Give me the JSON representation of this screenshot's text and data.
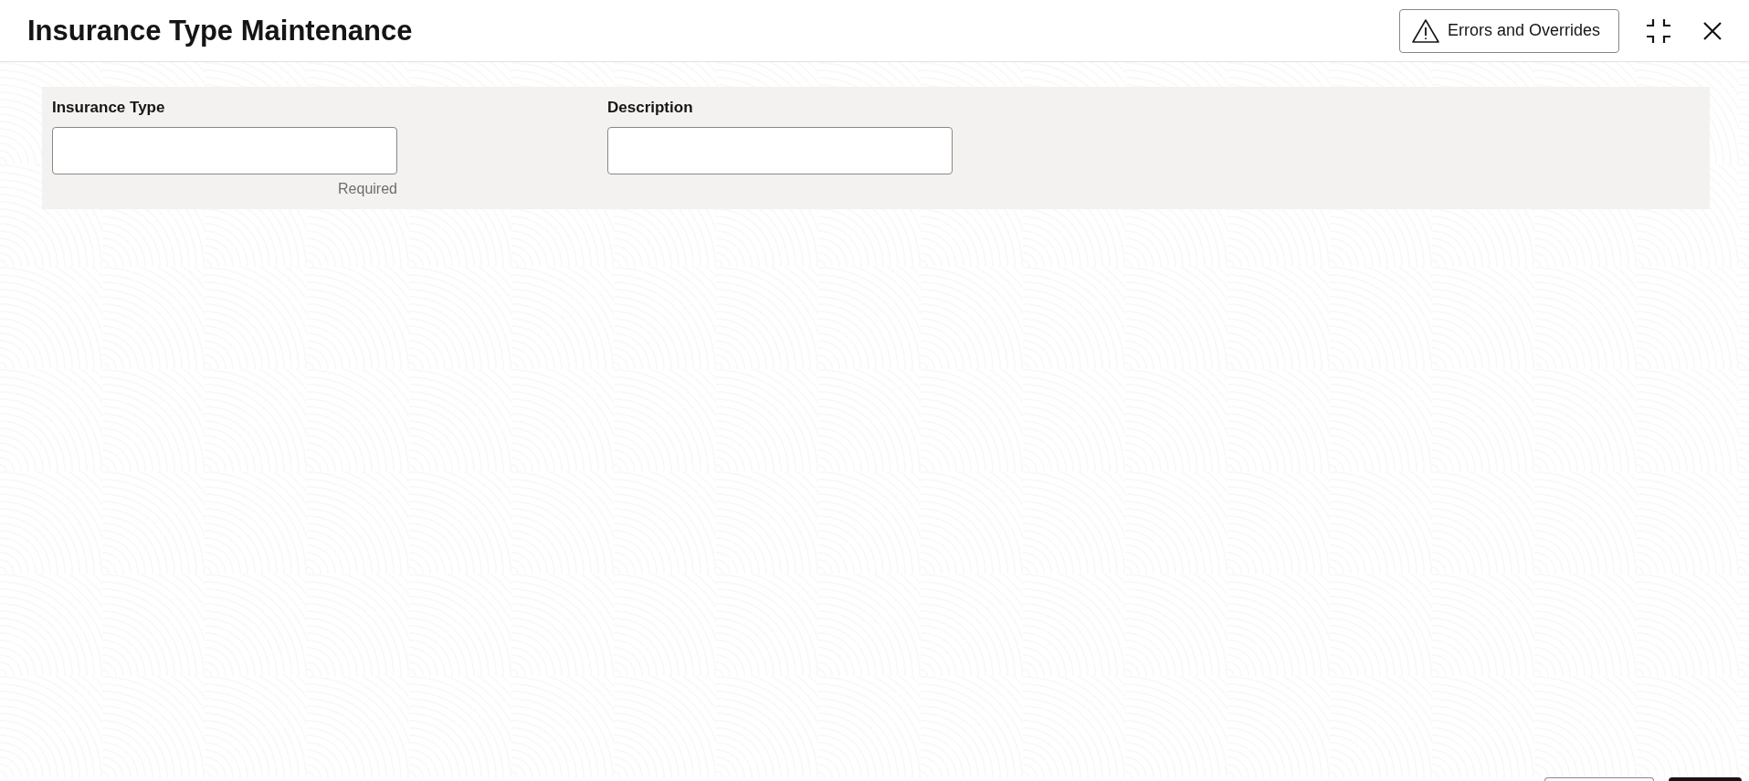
{
  "window": {
    "title": "Insurance Type Maintenance"
  },
  "header_buttons": {
    "errors": "Errors and Overrides"
  },
  "fields": [
    {
      "label": "Insurance Type",
      "helper": "Required"
    },
    {
      "label": "Description"
    }
  ],
  "footer_buttons": [
    {
      "kind": "secondary"
    },
    {
      "kind": "primary"
    }
  ]
}
